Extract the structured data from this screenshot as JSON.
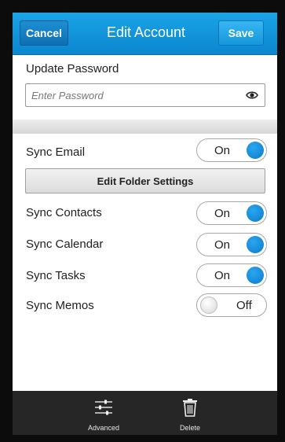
{
  "titlebar": {
    "cancel_label": "Cancel",
    "title": "Edit Account",
    "save_label": "Save"
  },
  "password": {
    "section_label": "Update Password",
    "placeholder": "Enter Password",
    "reveal_icon": "eye-icon"
  },
  "sync": [
    {
      "label": "Sync Email",
      "state": "On"
    },
    {
      "label": "Sync Contacts",
      "state": "On"
    },
    {
      "label": "Sync Calendar",
      "state": "On"
    },
    {
      "label": "Sync Tasks",
      "state": "On"
    },
    {
      "label": "Sync Memos",
      "state": "Off"
    }
  ],
  "edit_folder_label": "Edit Folder Settings",
  "actions": [
    {
      "label": "Advanced",
      "icon": "sliders-icon"
    },
    {
      "label": "Delete",
      "icon": "trash-icon"
    }
  ],
  "colors": {
    "accent": "#0b86cf",
    "toggle_on": "#0a7acd",
    "action_bar": "#262626"
  }
}
